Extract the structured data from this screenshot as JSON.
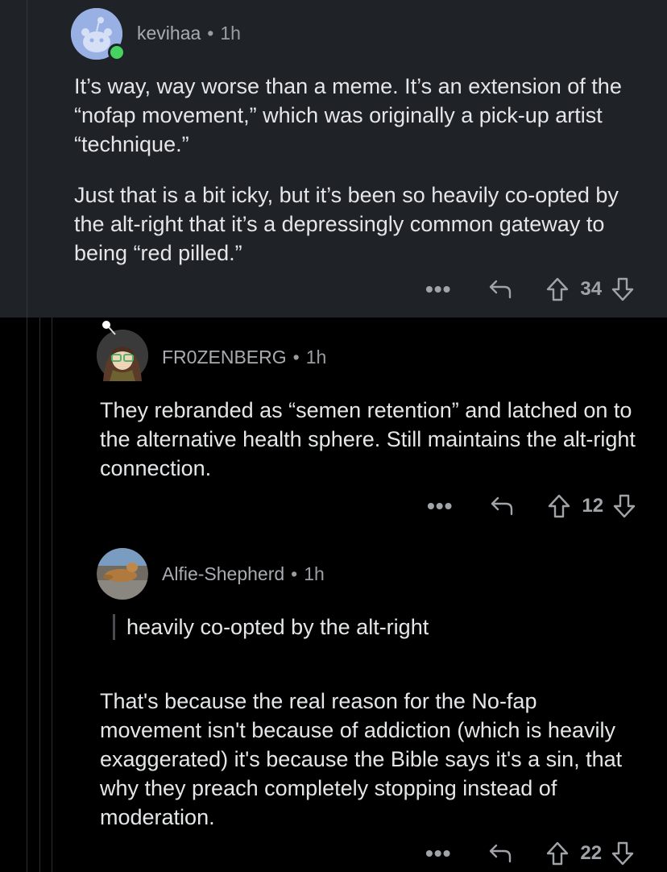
{
  "comments": [
    {
      "author": "kevihaa",
      "time": "1h",
      "paragraphs": [
        "It’s way, way worse than a meme. It’s an extension of the “nofap movement,” which was originally a pick-up artist “technique.”",
        "Just that is a bit icky, but it’s been so heavily co-opted by the alt-right that it’s a depressingly common gateway to being “red pilled.”"
      ],
      "score": "34"
    },
    {
      "author": "FR0ZENBERG",
      "time": "1h",
      "paragraphs": [
        "They rebranded as “semen retention” and latched on to the alternative health sphere. Still maintains the alt-right connection."
      ],
      "score": "12"
    },
    {
      "author": "Alfie-Shepherd",
      "time": "1h",
      "quote": "heavily co-opted by the alt-right",
      "paragraphs": [
        "That's because the real reason for the No-fap movement isn't because of addiction (which is heavily exaggerated) it's because the Bible says it's a sin, that why they preach completely stopping instead of moderation."
      ],
      "score": "22"
    }
  ],
  "separator": "•",
  "more_label": "•••",
  "icons": {
    "more": "ellipsis-icon",
    "reply": "reply-arrow-icon",
    "upvote": "upvote-arrow-icon",
    "downvote": "downvote-arrow-icon"
  },
  "colors": {
    "background": "#000000",
    "highlighted_comment": "#1f2227",
    "online_indicator": "#46d160"
  }
}
